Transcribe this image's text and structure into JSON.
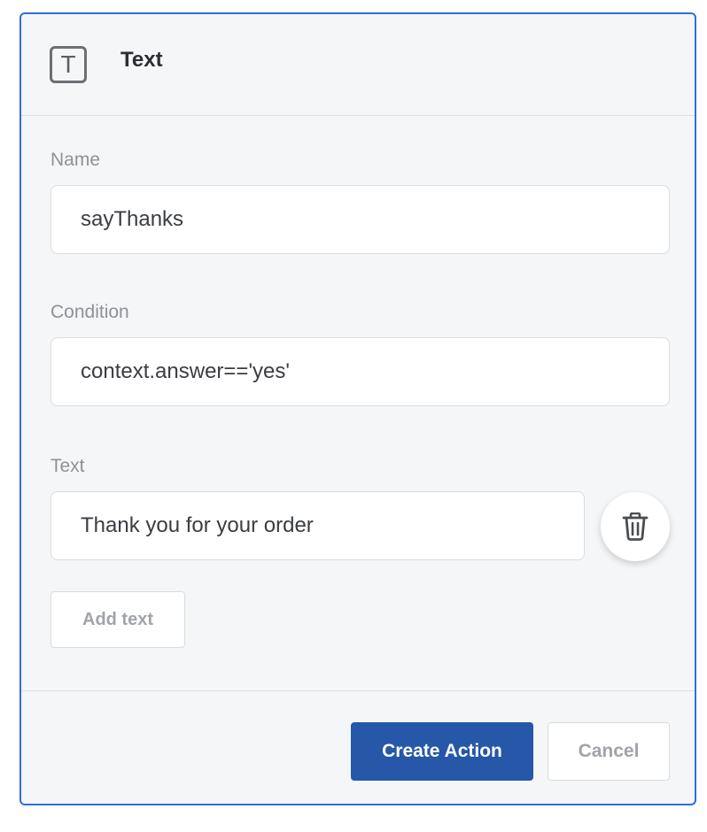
{
  "header": {
    "icon": "text-type-icon",
    "icon_glyph": "T",
    "title": "Text"
  },
  "fields": {
    "name": {
      "label": "Name",
      "value": "sayThanks"
    },
    "condition": {
      "label": "Condition",
      "value": "context.answer=='yes'"
    },
    "text": {
      "label": "Text",
      "value": "Thank you for your order",
      "delete_icon": "trash-icon"
    }
  },
  "add_text_label": "Add text",
  "footer": {
    "create_label": "Create Action",
    "cancel_label": "Cancel"
  },
  "colors": {
    "accent_border": "#2e6fd6",
    "primary_button": "#2657a8",
    "panel_background": "#f5f6f8"
  }
}
